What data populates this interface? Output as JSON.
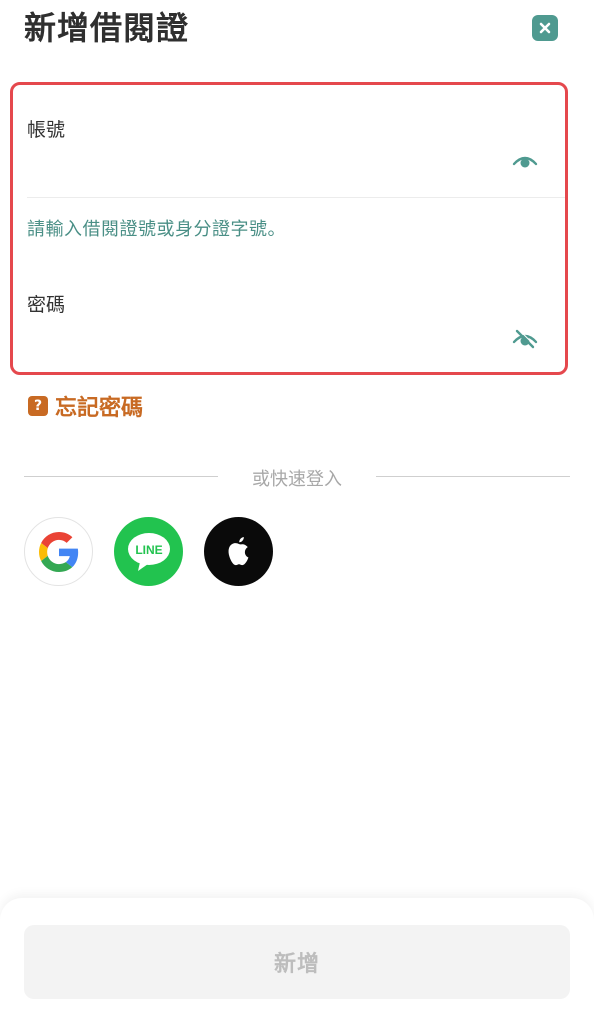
{
  "header": {
    "title": "新增借閱證",
    "close_icon": "close-icon"
  },
  "form": {
    "account": {
      "label": "帳號",
      "value": "",
      "placeholder": "",
      "toggle_icon": "eye-icon"
    },
    "hint": "請輸入借閱證號或身分證字號。",
    "password": {
      "label": "密碼",
      "value": "",
      "placeholder": "",
      "toggle_icon": "eye-off-icon"
    },
    "highlight_color": "#e5484d"
  },
  "forgot": {
    "icon_text": "?",
    "label": "忘記密碼",
    "color": "#c86a23"
  },
  "quick_login": {
    "label": "或快速登入",
    "providers": [
      {
        "name": "Google",
        "icon": "google-icon"
      },
      {
        "name": "LINE",
        "icon": "line-icon",
        "text": "LINE"
      },
      {
        "name": "Apple",
        "icon": "apple-icon"
      }
    ]
  },
  "footer": {
    "submit_label": "新增"
  },
  "colors": {
    "accent": "#4f9a90",
    "hint": "#4a8f86",
    "line_green": "#22c34f"
  }
}
